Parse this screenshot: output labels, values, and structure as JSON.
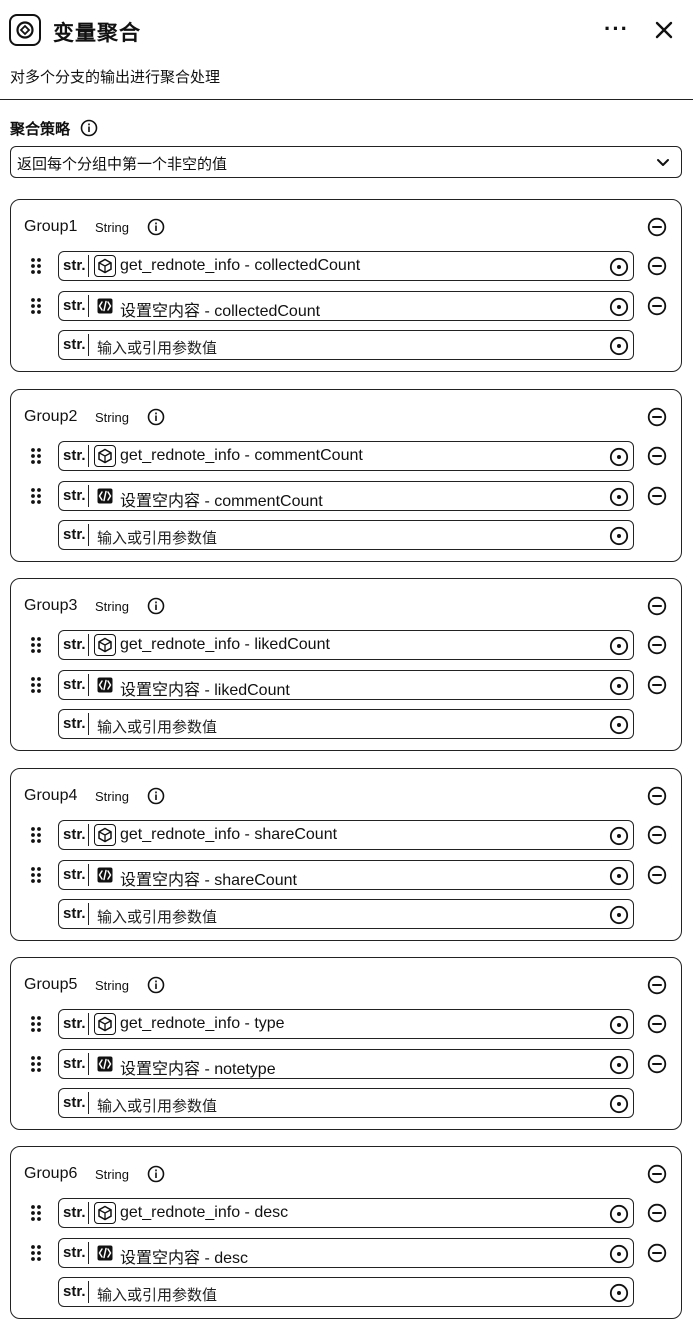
{
  "header": {
    "icon": "variable-aggregate-icon",
    "title": "变量聚合",
    "more_label": "···",
    "close_icon": "close-icon",
    "description": "对多个分支的输出进行聚合处理"
  },
  "strategy": {
    "label": "聚合策略",
    "selected": "返回每个分组中第一个非空的值"
  },
  "groups": [
    {
      "name": "Group1",
      "type": "String",
      "items": [
        {
          "tag": "str.",
          "icon": "code-node-icon",
          "text": "get_rednote_info - collectedCount"
        },
        {
          "tag": "str.",
          "icon": "logic-node-icon",
          "text": "设置空内容 - collectedCount"
        }
      ],
      "placeholder": {
        "tag": "str.",
        "text": "输入或引用参数值"
      }
    },
    {
      "name": "Group2",
      "type": "String",
      "items": [
        {
          "tag": "str.",
          "icon": "code-node-icon",
          "text": "get_rednote_info - commentCount"
        },
        {
          "tag": "str.",
          "icon": "logic-node-icon",
          "text": "设置空内容 - commentCount"
        }
      ],
      "placeholder": {
        "tag": "str.",
        "text": "输入或引用参数值"
      }
    },
    {
      "name": "Group3",
      "type": "String",
      "items": [
        {
          "tag": "str.",
          "icon": "code-node-icon",
          "text": "get_rednote_info - likedCount"
        },
        {
          "tag": "str.",
          "icon": "logic-node-icon",
          "text": "设置空内容 - likedCount"
        }
      ],
      "placeholder": {
        "tag": "str.",
        "text": "输入或引用参数值"
      }
    },
    {
      "name": "Group4",
      "type": "String",
      "items": [
        {
          "tag": "str.",
          "icon": "code-node-icon",
          "text": "get_rednote_info - shareCount"
        },
        {
          "tag": "str.",
          "icon": "logic-node-icon",
          "text": "设置空内容 - shareCount"
        }
      ],
      "placeholder": {
        "tag": "str.",
        "text": "输入或引用参数值"
      }
    },
    {
      "name": "Group5",
      "type": "String",
      "items": [
        {
          "tag": "str.",
          "icon": "code-node-icon",
          "text": "get_rednote_info - type"
        },
        {
          "tag": "str.",
          "icon": "logic-node-icon",
          "text": "设置空内容 - notetype"
        }
      ],
      "placeholder": {
        "tag": "str.",
        "text": "输入或引用参数值"
      }
    },
    {
      "name": "Group6",
      "type": "String",
      "items": [
        {
          "tag": "str.",
          "icon": "code-node-icon",
          "text": "get_rednote_info - desc"
        },
        {
          "tag": "str.",
          "icon": "logic-node-icon",
          "text": "设置空内容 - desc"
        }
      ],
      "placeholder": {
        "tag": "str.",
        "text": "输入或引用参数值"
      }
    }
  ]
}
